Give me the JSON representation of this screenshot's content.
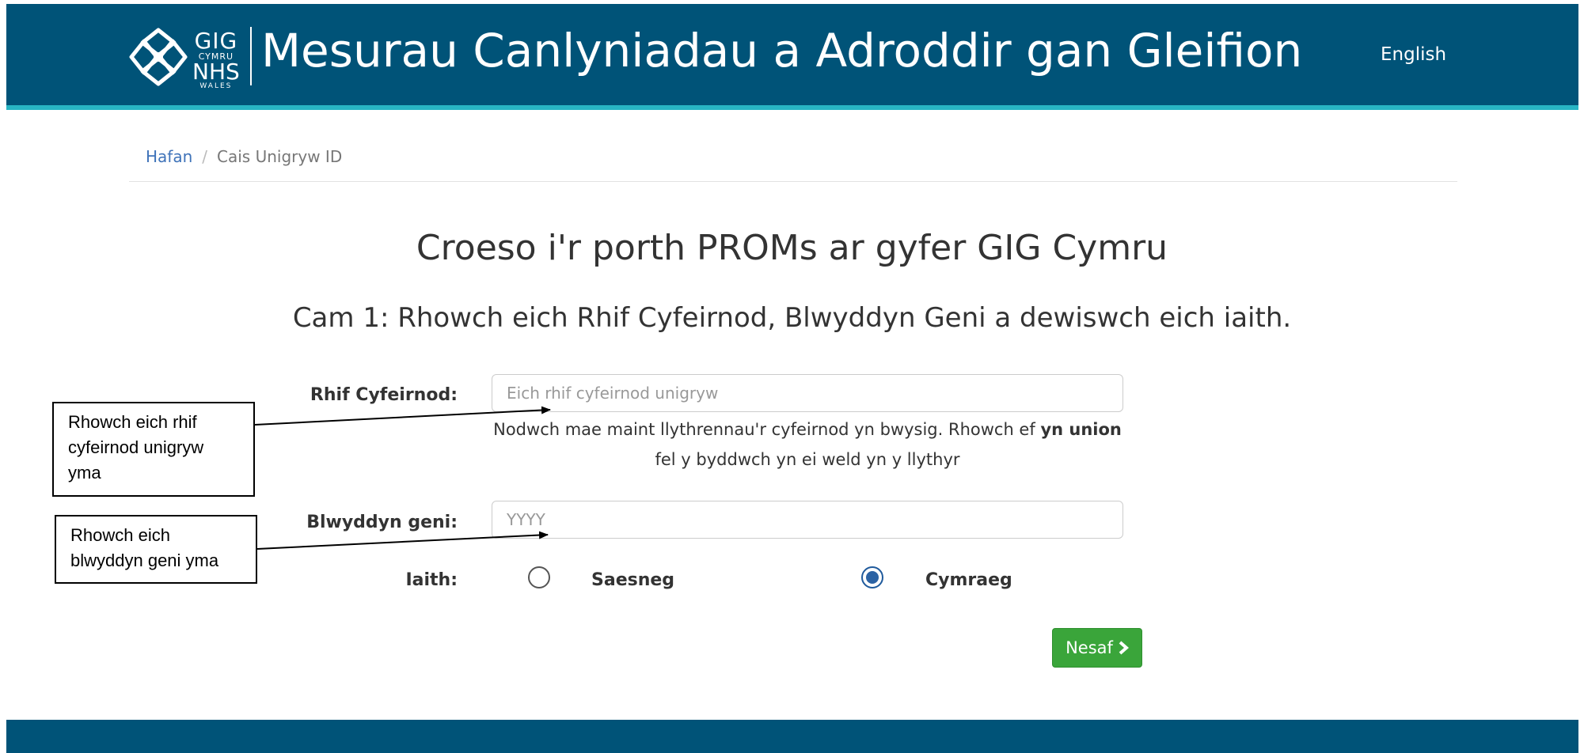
{
  "header": {
    "logo_line1": "GIG",
    "logo_line2": "CYMRU",
    "logo_line3": "NHS",
    "logo_line4": "WALES",
    "title": "Mesurau Canlyniadau a Adroddir gan Gleifion",
    "language_link": "English"
  },
  "breadcrumb": {
    "home": "Hafan",
    "separator": "/",
    "current": "Cais Unigryw ID"
  },
  "main": {
    "heading": "Croeso i'r porth PROMs ar gyfer GIG Cymru",
    "subheading": "Cam 1: Rhowch eich Rhif Cyfeirnod, Blwyddyn Geni a dewiswch eich iaith."
  },
  "form": {
    "ref_label": "Rhif Cyfeirnod:",
    "ref_placeholder": "Eich rhif cyfeirnod unigryw",
    "help_text_1": "Nodwch mae maint llythrennau'r cyfeirnod yn bwysig. Rhowch ef ",
    "help_text_bold": "yn union",
    "help_text_2": "fel y byddwch yn ei weld yn y llythyr",
    "year_label": "Blwyddyn geni:",
    "year_placeholder": "YYYY",
    "language_label": "Iaith:",
    "options": [
      {
        "label": "Saesneg",
        "selected": false
      },
      {
        "label": "Cymraeg",
        "selected": true
      }
    ],
    "next_button": "Nesaf",
    "next_icon": "chevron-right-icon"
  },
  "callouts": {
    "ref_callout": "Rhowch eich rhif cyfeirnod unigryw yma",
    "year_callout": "Rhowch eich blwyddyn geni yma"
  },
  "colors": {
    "header_bg": "#005378",
    "accent_stripe": "#28b5c4",
    "button_green": "#3aa53a",
    "link_blue": "#3f73b9"
  }
}
